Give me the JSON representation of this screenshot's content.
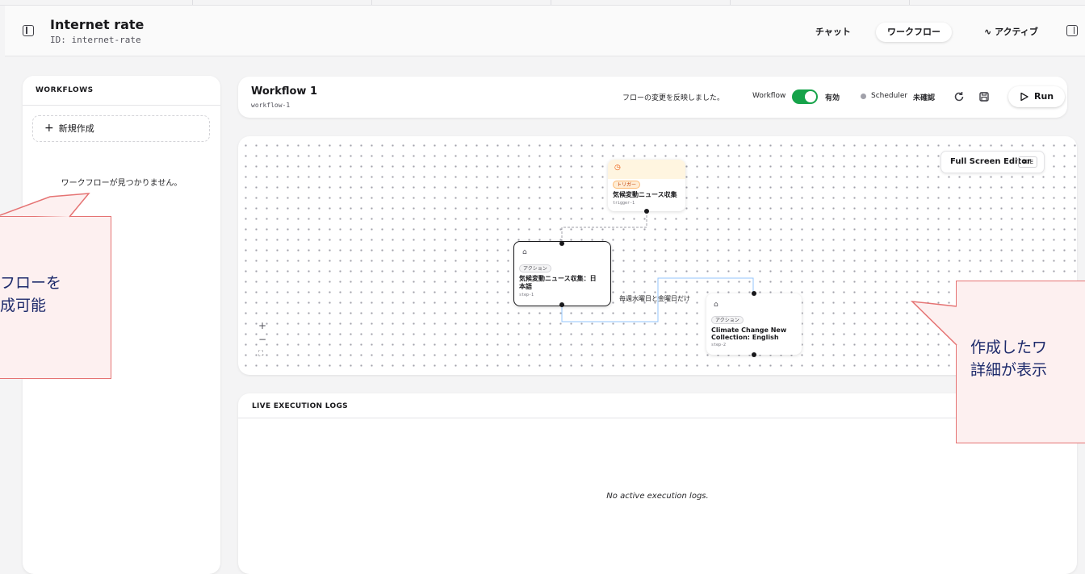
{
  "header": {
    "title": "Internet rate",
    "id_label": "ID: internet-rate",
    "tabs": [
      "チャット",
      "ワークフロー"
    ],
    "active_label": "アクティブ"
  },
  "sidebar": {
    "title": "WORKFLOWS",
    "new_button": "新規作成",
    "empty_message": "ワークフローが見つかりません。"
  },
  "workflow": {
    "name": "Workflow 1",
    "slug": "workflow-1",
    "status_message": "フローの変更を反映しました。",
    "toggle_label": "Workflow",
    "toggle_state": "有効",
    "scheduler_label": "Scheduler",
    "scheduler_state": "未確認",
    "run_label": "Run",
    "accent_color": "#16a34a"
  },
  "canvas": {
    "fullscreen_label": "Full Screen Editor",
    "fullscreen_shortcut": "⌘ E",
    "edge_label": "毎週水曜日と金曜日だけ",
    "nodes": [
      {
        "type_label": "トリガー",
        "title": "気候変動ニュース収集",
        "id": "trigger-1",
        "icon": "clock-icon"
      },
      {
        "type_label": "アクション",
        "title_line1": "気候変動ニュース収集：日",
        "title_line2": "本語",
        "id": "step-1",
        "icon": "robot-icon"
      },
      {
        "type_label": "アクション",
        "title_line1": "Climate Change New",
        "title_line2": "Collection: English",
        "id": "step-2",
        "icon": "robot-icon"
      }
    ]
  },
  "logs": {
    "title": "LIVE EXECUTION LOGS",
    "empty_message": "No active execution logs."
  },
  "annotations": {
    "left": {
      "line1": "フローを",
      "line2": "成可能"
    },
    "right": {
      "line1": "作成したワ",
      "line2": "詳細が表示"
    }
  }
}
